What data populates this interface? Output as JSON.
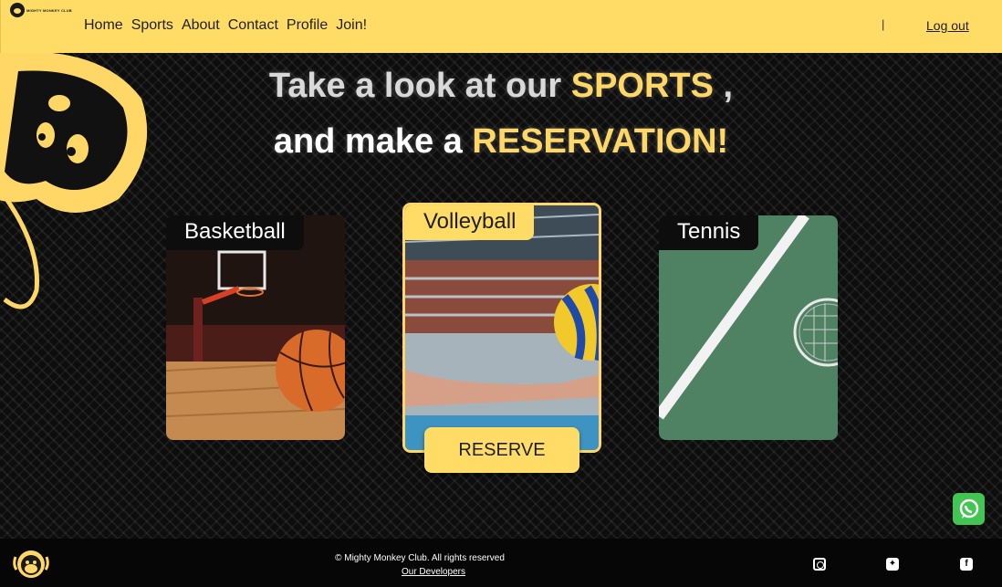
{
  "header": {
    "logo_text": "MIGHTY MONKEY CLUB",
    "nav": [
      {
        "label": "Home"
      },
      {
        "label": "Sports"
      },
      {
        "label": "About"
      },
      {
        "label": "Contact"
      },
      {
        "label": "Profile"
      },
      {
        "label": "Join!"
      }
    ],
    "separator": "|",
    "logout_label": "Log out"
  },
  "hero": {
    "line1_pre": "Take a look at our ",
    "line1_highlight": "SPORTS",
    "line1_post": " ,",
    "line2_pre": "and make a ",
    "line2_highlight": "RESERVATION!"
  },
  "sports": [
    {
      "label": "Basketball",
      "icon": "basketball-image"
    },
    {
      "label": "Volleyball",
      "icon": "volleyball-image",
      "active": true
    },
    {
      "label": "Tennis",
      "icon": "tennis-image"
    }
  ],
  "reserve_label": "RESERVE",
  "footer": {
    "copyright": "© Mighty Monkey Club. All rights reserved",
    "developers": "Our Developers",
    "social": [
      "instagram-icon",
      "twitter-icon",
      "facebook-icon"
    ]
  },
  "colors": {
    "brand_yellow": "#fedc66",
    "headline_highlight": "#fed766",
    "whatsapp_green": "#43c553",
    "background": "#0b0b0b"
  }
}
